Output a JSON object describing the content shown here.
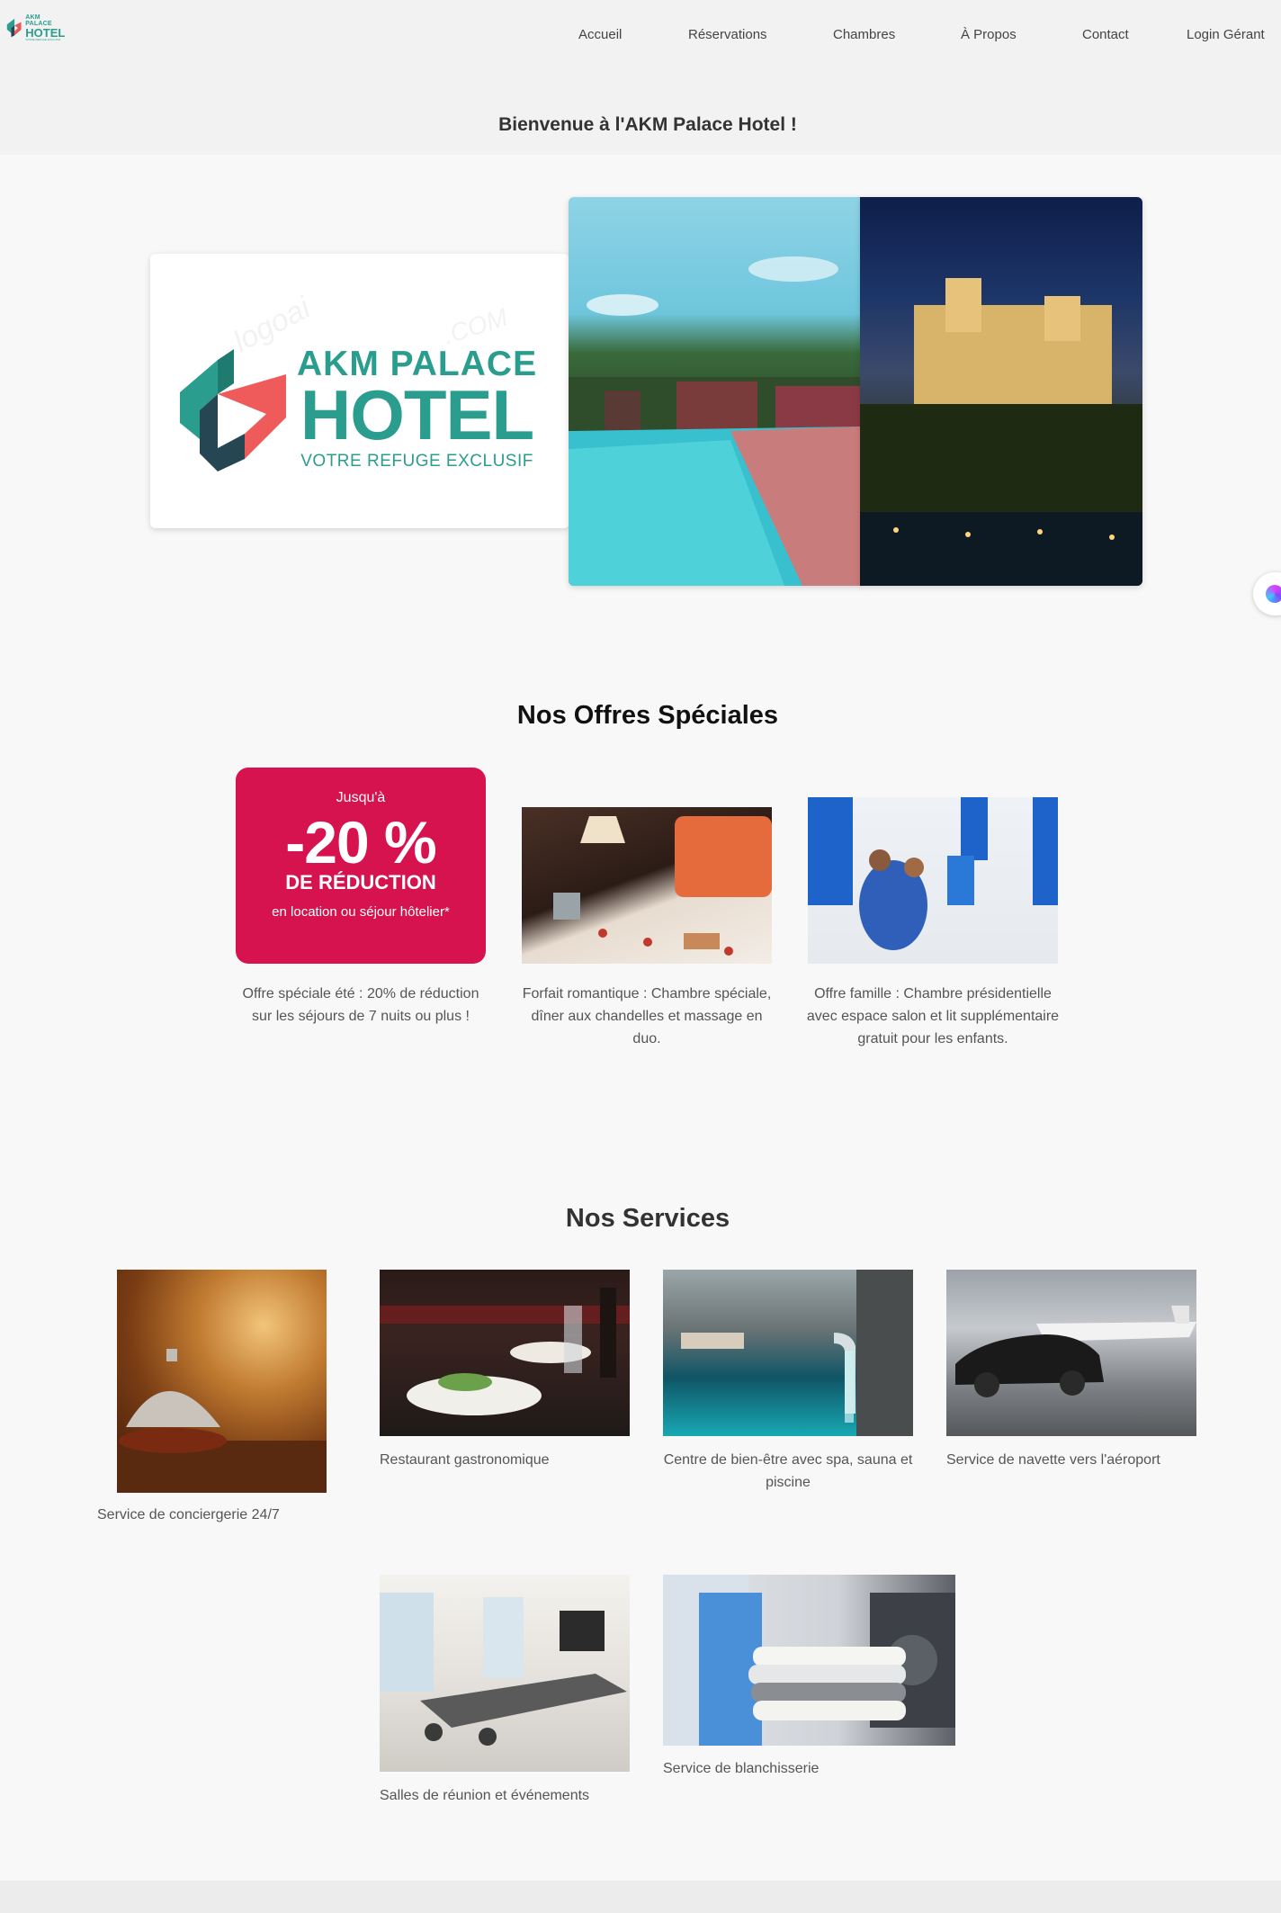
{
  "header": {
    "logo": {
      "line1": "AKM PALACE",
      "line2": "HOTEL",
      "line3": "VOTRE REFUGE EXCLUSIF"
    },
    "nav": [
      "Accueil",
      "Réservations",
      "Chambres",
      "À Propos",
      "Contact",
      "Login Gérant"
    ],
    "welcome": "Bienvenue à l'AKM Palace Hotel !"
  },
  "hero": {
    "logo": {
      "line1": "AKM PALACE",
      "line2": "HOTEL",
      "tagline": "VOTRE REFUGE EXCLUSIF"
    },
    "watermark": [
      "logoai",
      ".COM"
    ]
  },
  "offres": {
    "title": "Nos Offres Spéciales",
    "promo": {
      "line1": "Jusqu'à",
      "line2": "-20 %",
      "line3": "DE RÉDUCTION",
      "line4": "en location ou séjour hôtelier*"
    },
    "items": [
      {
        "caption": "Offre spéciale été : 20% de réduction sur les séjours de 7 nuits ou plus !"
      },
      {
        "caption": "Forfait romantique : Chambre spéciale, dîner aux chandelles et massage en duo."
      },
      {
        "caption": "Offre famille : Chambre présidentielle avec espace salon et lit supplémentaire gratuit pour les enfants."
      }
    ]
  },
  "services": {
    "title": "Nos Services",
    "items": [
      {
        "caption": "Service de conciergerie 24/7"
      },
      {
        "caption": "Restaurant gastronomique"
      },
      {
        "caption": "Centre de bien-être avec spa, sauna et piscine"
      },
      {
        "caption": "Service de navette vers l'aéroport"
      },
      {
        "caption": "Salles de réunion et événements"
      },
      {
        "caption": "Service de blanchisserie"
      }
    ]
  },
  "colors": {
    "brand_teal": "#2a9d8f",
    "brand_red": "#e85a5a",
    "promo_pink": "#d6124f"
  }
}
